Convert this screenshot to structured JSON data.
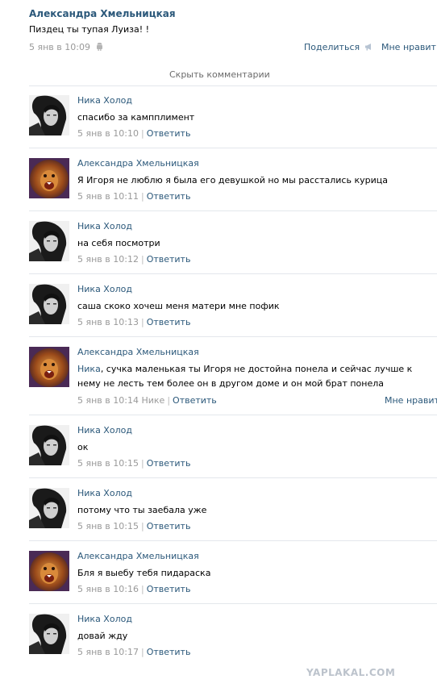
{
  "post": {
    "author": "Александра Хмельницкая",
    "text": "Пиздец ты тупая Луиза! !",
    "time": "5 янв в 10:09",
    "share": "Поделиться",
    "like": "Мне нравит"
  },
  "hide_comments": "Скрыть комментарии",
  "comments": [
    {
      "author": "Ника Холод",
      "text": "спасибо за кампплимент",
      "time": "5 янв в 10:10",
      "reply": "Ответить",
      "avatar": "girl"
    },
    {
      "author": "Александра Хмельницкая",
      "text": "Я Игоря не люблю я была его девушкой но мы расстались курица",
      "time": "5 янв в 10:11",
      "reply": "Ответить",
      "avatar": "lion"
    },
    {
      "author": "Ника Холод",
      "text": "на себя посмотри",
      "time": "5 янв в 10:12",
      "reply": "Ответить",
      "avatar": "girl"
    },
    {
      "author": "Ника Холод",
      "text": "саша скоко хочеш меня матери мне пофик",
      "time": "5 янв в 10:13",
      "reply": "Ответить",
      "avatar": "girl"
    },
    {
      "author": "Александра Хмельницкая",
      "mention": "Ника",
      "text": ", сучка маленькая ты Игоря не достойна понела и сейчас лучше к нему не лесть тем более он в другом доме и он мой брат понела",
      "time": "5 янв в 10:14",
      "to": "Нике",
      "reply": "Ответить",
      "like": "Мне нравит",
      "avatar": "lion"
    },
    {
      "author": "Ника Холод",
      "text": "ок",
      "time": "5 янв в 10:15",
      "reply": "Ответить",
      "avatar": "girl"
    },
    {
      "author": "Ника Холод",
      "text": "потому что ты заебала уже",
      "time": "5 янв в 10:15",
      "reply": "Ответить",
      "avatar": "girl"
    },
    {
      "author": "Александра Хмельницкая",
      "text": "Бля я выебу тебя пидараска",
      "time": "5 янв в 10:16",
      "reply": "Ответить",
      "avatar": "lion"
    },
    {
      "author": "Ника Холод",
      "text": "довай жду",
      "time": "5 янв в 10:17",
      "reply": "Ответить",
      "avatar": "girl"
    }
  ],
  "watermark": "YAPLAKAL.COM"
}
